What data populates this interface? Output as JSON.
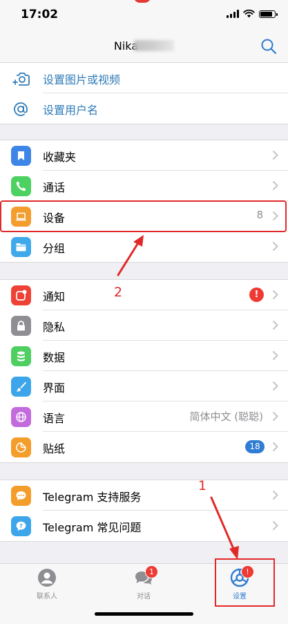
{
  "status": {
    "time": "17:02"
  },
  "header": {
    "title": "Nika"
  },
  "profile_actions": [
    {
      "label": "设置图片或视频",
      "icon": "camera-plus-icon"
    },
    {
      "label": "设置用户名",
      "icon": "at-sign-icon"
    }
  ],
  "groups": {
    "main": [
      {
        "label": "收藏夹",
        "icon": "bookmark-icon",
        "color": "#3d86e8"
      },
      {
        "label": "通话",
        "icon": "phone-icon",
        "color": "#4cd260"
      },
      {
        "label": "设备",
        "icon": "laptop-icon",
        "color": "#f29d2e",
        "value": "8"
      },
      {
        "label": "分组",
        "icon": "folder-icon",
        "color": "#3fa9ea"
      }
    ],
    "settings": [
      {
        "label": "通知",
        "icon": "notification-icon",
        "color": "#ef4236",
        "badge": "!"
      },
      {
        "label": "隐私",
        "icon": "lock-icon",
        "color": "#8e8e93"
      },
      {
        "label": "数据",
        "icon": "database-icon",
        "color": "#4fcf62"
      },
      {
        "label": "界面",
        "icon": "brush-icon",
        "color": "#3da6ea"
      },
      {
        "label": "语言",
        "icon": "globe-icon",
        "color": "#c36bdc",
        "value": "简体中文 (聪聪)"
      },
      {
        "label": "贴纸",
        "icon": "sticker-icon",
        "color": "#f39d2a",
        "count": "18"
      }
    ],
    "help": [
      {
        "label": "Telegram 支持服务",
        "icon": "chat-dots-icon",
        "color": "#f39d2a"
      },
      {
        "label": "Telegram 常见问题",
        "icon": "question-icon",
        "color": "#3da6ea"
      }
    ]
  },
  "annotations": {
    "step1": "1",
    "step2": "2"
  },
  "tabs": [
    {
      "label": "联系人",
      "icon": "contacts-icon"
    },
    {
      "label": "对话",
      "icon": "chats-icon",
      "badge": "1"
    },
    {
      "label": "设置",
      "icon": "settings-icon",
      "badge": "!"
    }
  ],
  "colors": {
    "accent": "#2f7bd3",
    "annotation": "#e22929",
    "badge": "#ee3a33"
  }
}
